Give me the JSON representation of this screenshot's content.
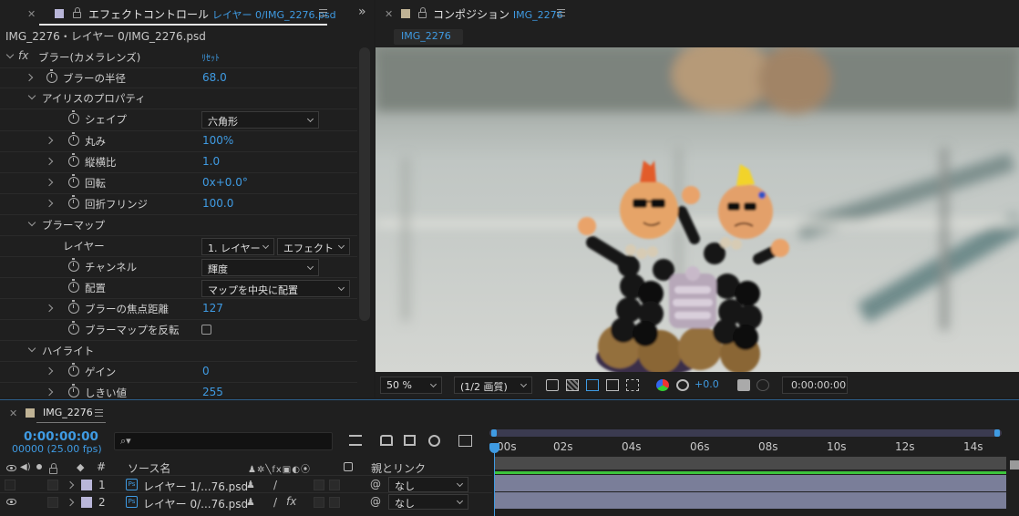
{
  "effect_panel": {
    "tab_title": "エフェクトコントロール",
    "tab_layer": "レイヤー 0/IMG_2276.psd",
    "subtitle": "IMG_2276・レイヤー 0/IMG_2276.psd",
    "effect_name": "ブラー(カメラレンズ)",
    "reset": "ﾘｾｯﾄ",
    "props": {
      "blur_radius": {
        "label": "ブラーの半径",
        "value": "68.0"
      },
      "iris_group": {
        "label": "アイリスのプロパティ"
      },
      "shape": {
        "label": "シェイプ",
        "value": "六角形"
      },
      "roundness": {
        "label": "丸み",
        "value": "100%"
      },
      "aspect": {
        "label": "縦横比",
        "value": "1.0"
      },
      "rotation": {
        "label": "回転",
        "value": "0x+0.0°"
      },
      "fringe": {
        "label": "回折フリンジ",
        "value": "100.0"
      },
      "blur_map": {
        "label": "ブラーマップ"
      },
      "layer": {
        "label": "レイヤー",
        "value": "1. レイヤー",
        "value2": "エフェクト"
      },
      "channel": {
        "label": "チャンネル",
        "value": "輝度"
      },
      "placement": {
        "label": "配置",
        "value": "マップを中央に配置"
      },
      "focal": {
        "label": "ブラーの焦点距離",
        "value": "127"
      },
      "invert": {
        "label": "ブラーマップを反転"
      },
      "highlight": {
        "label": "ハイライト"
      },
      "gain": {
        "label": "ゲイン",
        "value": "0"
      },
      "threshold": {
        "label": "しきい値",
        "value": "255"
      }
    }
  },
  "comp_panel": {
    "tab_title": "コンポジション",
    "tab_comp": "IMG_2276",
    "sub_tab": "IMG_2276",
    "zoom": "50 %",
    "quality": "(1/2 画質)",
    "exposure": "+0.0",
    "timecode": "0:00:00:00"
  },
  "timeline": {
    "tab": "IMG_2276",
    "time": "0:00:00:00",
    "fps": "00000 (25.00 fps)",
    "ticks": [
      ":00s",
      "02s",
      "04s",
      "06s",
      "08s",
      "10s",
      "12s",
      "14s"
    ],
    "col_hash": "#",
    "col_source": "ソース名",
    "col_parent": "親とリンク",
    "layers": [
      {
        "num": "1",
        "name": "レイヤー 1/...76.psd",
        "parent": "なし"
      },
      {
        "num": "2",
        "name": "レイヤー 0/...76.psd",
        "parent": "なし"
      }
    ]
  },
  "colors": {
    "accent": "#3f9be3",
    "layer_label": "#b9b6d9",
    "bar": "#7a7e99",
    "work_area_green": "#3cc43c"
  }
}
